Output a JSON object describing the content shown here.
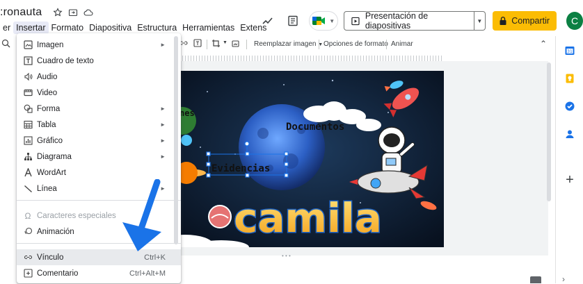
{
  "doc": {
    "title": ":ronauta"
  },
  "menubar": {
    "items": [
      "er",
      "Insertar",
      "Formato",
      "Diapositiva",
      "Estructura",
      "Herramientas",
      "Extens"
    ],
    "active_index": 1
  },
  "top_actions": {
    "present_label": "Presentación de diapositivas",
    "share_label": "Compartir",
    "avatar_letter": "C"
  },
  "format_toolbar": {
    "replace_image": "Reemplazar imagen",
    "format_options": "Opciones de formato",
    "animate": "Animar"
  },
  "insert_menu": {
    "items": [
      {
        "label": "Imagen",
        "icon": "image-icon",
        "submenu": true
      },
      {
        "label": "Cuadro de texto",
        "icon": "text-box-icon",
        "submenu": false
      },
      {
        "label": "Audio",
        "icon": "audio-icon",
        "submenu": false
      },
      {
        "label": "Video",
        "icon": "video-icon",
        "submenu": false
      },
      {
        "label": "Forma",
        "icon": "shape-icon",
        "submenu": true
      },
      {
        "label": "Tabla",
        "icon": "table-icon",
        "submenu": true
      },
      {
        "label": "Gráfico",
        "icon": "chart-icon",
        "submenu": true
      },
      {
        "label": "Diagrama",
        "icon": "diagram-icon",
        "submenu": true
      },
      {
        "label": "WordArt",
        "icon": "wordart-icon",
        "submenu": false
      },
      {
        "label": "Línea",
        "icon": "line-icon",
        "submenu": true
      },
      {
        "label": "Caracteres especiales",
        "icon": "omega-icon",
        "submenu": false,
        "disabled": true
      },
      {
        "label": "Animación",
        "icon": "animation-icon",
        "submenu": false
      },
      {
        "label": "Vínculo",
        "icon": "link-icon",
        "shortcut": "Ctrl+K"
      },
      {
        "label": "Comentario",
        "icon": "comment-icon",
        "shortcut": "Ctrl+Alt+M"
      }
    ]
  },
  "slide": {
    "text_documentos": "Documentos",
    "text_evidencias": "Evidencias",
    "text_partial": "nes",
    "text_camila": "camila"
  },
  "colors": {
    "accent_blue": "#1a73e8",
    "share_yellow": "#fbbc04",
    "avatar_green": "#0b8043",
    "slide_bg": "#0c1a2e"
  }
}
